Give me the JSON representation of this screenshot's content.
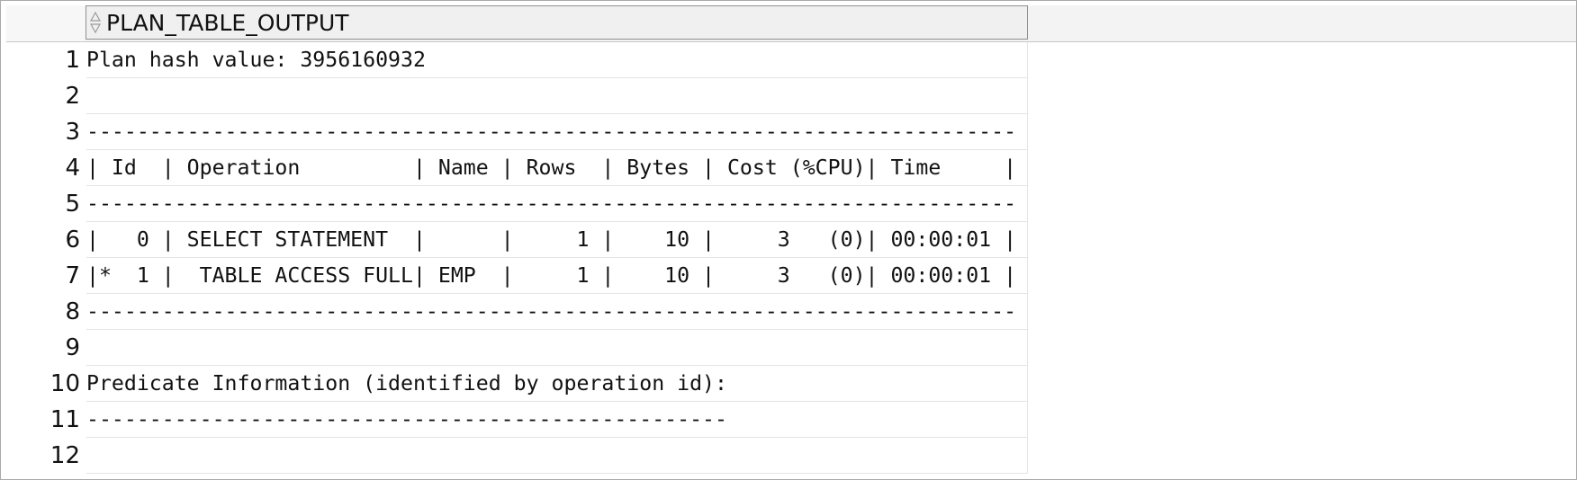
{
  "grid": {
    "column_header": "PLAN_TABLE_OUTPUT",
    "rows": [
      {
        "num": "1",
        "text": "Plan hash value: 3956160932"
      },
      {
        "num": "2",
        "text": ""
      },
      {
        "num": "3",
        "text": "--------------------------------------------------------------------------"
      },
      {
        "num": "4",
        "text": "| Id  | Operation         | Name | Rows  | Bytes | Cost (%CPU)| Time     |"
      },
      {
        "num": "5",
        "text": "--------------------------------------------------------------------------"
      },
      {
        "num": "6",
        "text": "|   0 | SELECT STATEMENT  |      |     1 |    10 |     3   (0)| 00:00:01 |"
      },
      {
        "num": "7",
        "text": "|*  1 |  TABLE ACCESS FULL| EMP  |     1 |    10 |     3   (0)| 00:00:01 |"
      },
      {
        "num": "8",
        "text": "--------------------------------------------------------------------------"
      },
      {
        "num": "9",
        "text": ""
      },
      {
        "num": "10",
        "text": "Predicate Information (identified by operation id):"
      },
      {
        "num": "11",
        "text": "---------------------------------------------------"
      },
      {
        "num": "12",
        "text": ""
      }
    ]
  }
}
